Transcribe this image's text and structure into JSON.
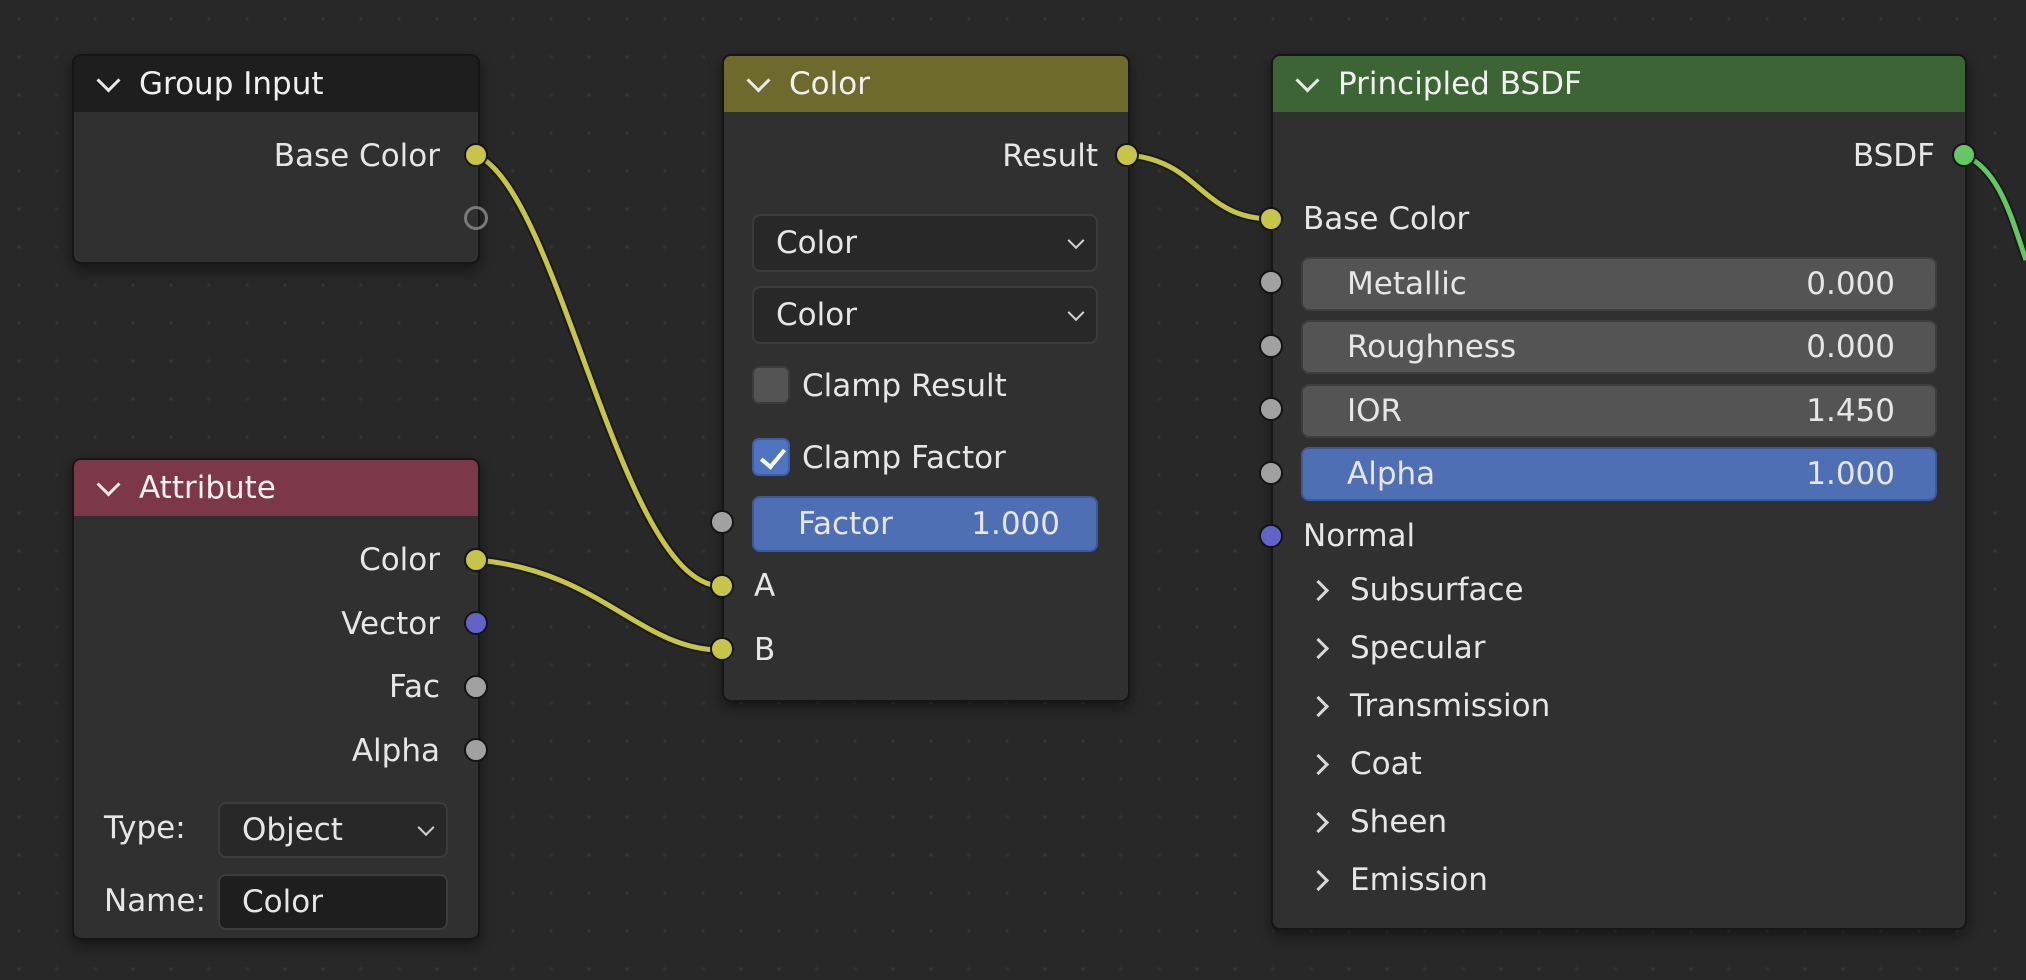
{
  "colors": {
    "canvas": "#282828",
    "node_body": "#303030",
    "socket_color": "#c7c44a",
    "socket_vector": "#6363c7",
    "socket_float": "#a1a1a1",
    "socket_shader": "#63c763",
    "header_group_input": "#1e1e1e",
    "header_attribute": "#7c3748",
    "header_mix": "#6e6a2e",
    "header_bsdf": "#3d6434",
    "link_color": "#c7c44a",
    "link_shader": "#63c763"
  },
  "group_input": {
    "title": "Group Input",
    "outputs": [
      "Base Color"
    ]
  },
  "attribute": {
    "title": "Attribute",
    "outputs": [
      "Color",
      "Vector",
      "Fac",
      "Alpha"
    ],
    "type_label": "Type:",
    "type_value": "Object",
    "name_label": "Name:",
    "name_value": "Color"
  },
  "mix": {
    "title": "Color",
    "output": "Result",
    "data_type": "Color",
    "blend_type": "Color",
    "clamp_result_label": "Clamp Result",
    "clamp_result_checked": false,
    "clamp_factor_label": "Clamp Factor",
    "clamp_factor_checked": true,
    "factor_label": "Factor",
    "factor_value": "1.000",
    "input_a": "A",
    "input_b": "B"
  },
  "bsdf": {
    "title": "Principled BSDF",
    "output": "BSDF",
    "base_color": "Base Color",
    "fields": [
      {
        "label": "Metallic",
        "value": "0.000"
      },
      {
        "label": "Roughness",
        "value": "0.000"
      },
      {
        "label": "IOR",
        "value": "1.450"
      },
      {
        "label": "Alpha",
        "value": "1.000"
      }
    ],
    "normal": "Normal",
    "panels": [
      "Subsurface",
      "Specular",
      "Transmission",
      "Coat",
      "Sheen",
      "Emission"
    ]
  }
}
